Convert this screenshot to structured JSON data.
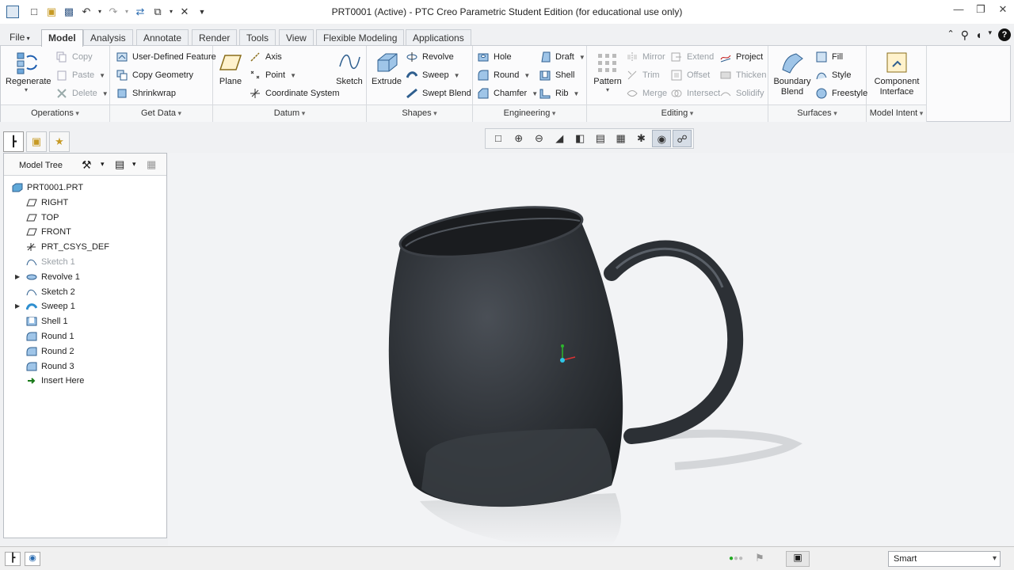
{
  "window": {
    "title": "PRT0001 (Active) - PTC Creo Parametric Student Edition (for educational use only)"
  },
  "tabs": [
    {
      "label": "File"
    },
    {
      "label": "Model"
    },
    {
      "label": "Analysis"
    },
    {
      "label": "Annotate"
    },
    {
      "label": "Render"
    },
    {
      "label": "Tools"
    },
    {
      "label": "View"
    },
    {
      "label": "Flexible Modeling"
    },
    {
      "label": "Applications"
    }
  ],
  "ribbon": {
    "operations": {
      "label": "Operations",
      "regenerate": "Regenerate",
      "copy": "Copy",
      "paste": "Paste",
      "delete": "Delete"
    },
    "get_data": {
      "label": "Get Data",
      "udf": "User-Defined Feature",
      "copy_geometry": "Copy Geometry",
      "shrinkwrap": "Shrinkwrap"
    },
    "datum": {
      "label": "Datum",
      "plane": "Plane",
      "axis": "Axis",
      "point": "Point",
      "csys": "Coordinate System",
      "sketch": "Sketch"
    },
    "shapes": {
      "label": "Shapes",
      "extrude": "Extrude",
      "revolve": "Revolve",
      "sweep": "Sweep",
      "swept_blend": "Swept Blend"
    },
    "engineering": {
      "label": "Engineering",
      "hole": "Hole",
      "round": "Round",
      "chamfer": "Chamfer",
      "draft": "Draft",
      "shell": "Shell",
      "rib": "Rib"
    },
    "editing": {
      "label": "Editing",
      "pattern": "Pattern",
      "mirror": "Mirror",
      "trim": "Trim",
      "merge": "Merge",
      "extend": "Extend",
      "offset": "Offset",
      "intersect": "Intersect",
      "project": "Project",
      "thicken": "Thicken",
      "solidify": "Solidify"
    },
    "surfaces": {
      "label": "Surfaces",
      "boundary_blend": "Boundary Blend",
      "fill": "Fill",
      "style": "Style",
      "freestyle": "Freestyle"
    },
    "model_intent": {
      "label": "Model Intent",
      "component_interface": "Component Interface"
    }
  },
  "model_tree": {
    "header": "Model Tree",
    "items": [
      {
        "label": "PRT0001.PRT",
        "icon": "part-icon"
      },
      {
        "label": "RIGHT",
        "icon": "datum-plane-icon"
      },
      {
        "label": "TOP",
        "icon": "datum-plane-icon"
      },
      {
        "label": "FRONT",
        "icon": "datum-plane-icon"
      },
      {
        "label": "PRT_CSYS_DEF",
        "icon": "csys-icon"
      },
      {
        "label": "Sketch 1",
        "icon": "sketch-icon"
      },
      {
        "label": "Revolve 1",
        "icon": "revolve-icon"
      },
      {
        "label": "Sketch 2",
        "icon": "sketch-icon"
      },
      {
        "label": "Sweep 1",
        "icon": "sweep-icon"
      },
      {
        "label": "Shell 1",
        "icon": "shell-icon"
      },
      {
        "label": "Round 1",
        "icon": "round-icon"
      },
      {
        "label": "Round 2",
        "icon": "round-icon"
      },
      {
        "label": "Round 3",
        "icon": "round-icon"
      },
      {
        "label": "Insert Here",
        "icon": "insert-arrow-icon"
      }
    ]
  },
  "status": {
    "filter": "Smart"
  }
}
